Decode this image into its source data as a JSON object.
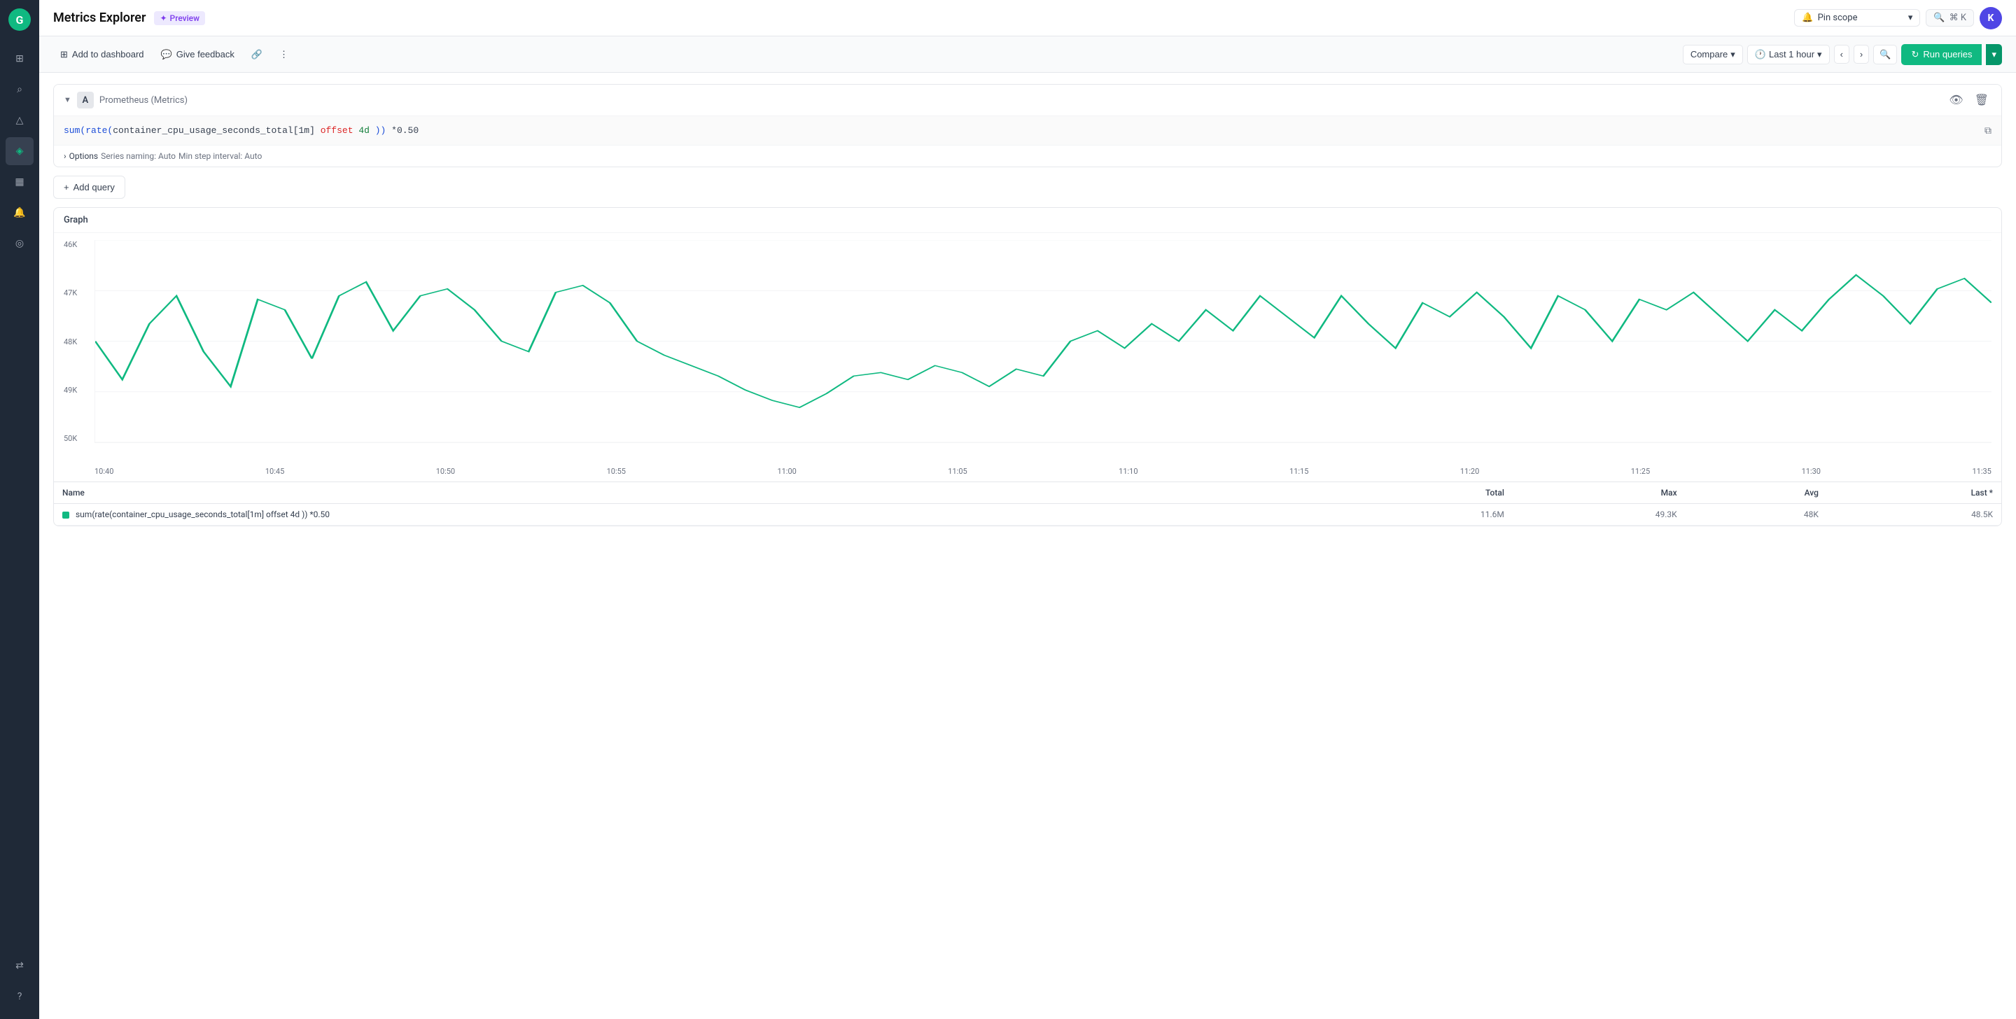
{
  "app": {
    "title": "Metrics Explorer",
    "preview_label": "Preview"
  },
  "sidebar": {
    "logo": "G",
    "items": [
      {
        "name": "home",
        "icon": "⊞",
        "active": false
      },
      {
        "name": "search",
        "icon": "⌕",
        "active": false
      },
      {
        "name": "alerts",
        "icon": "△",
        "active": false
      },
      {
        "name": "metrics",
        "icon": "◈",
        "active": true
      },
      {
        "name": "dashboard",
        "icon": "▦",
        "active": false
      },
      {
        "name": "bell",
        "icon": "🔔",
        "active": false
      },
      {
        "name": "explore",
        "icon": "◎",
        "active": false
      }
    ],
    "bottom_items": [
      {
        "name": "integrations",
        "icon": "⇄"
      },
      {
        "name": "help",
        "icon": "?"
      }
    ]
  },
  "pinscope": {
    "label": "Pin scope",
    "icon": "🔔",
    "placeholder": "Pin scope"
  },
  "search": {
    "label": "⌘ K"
  },
  "user": {
    "avatar_letter": "K"
  },
  "toolbar": {
    "add_to_dashboard_label": "Add to dashboard",
    "give_feedback_label": "Give feedback",
    "compare_label": "Compare",
    "time_label": "Last 1 hour",
    "run_queries_label": "Run queries"
  },
  "query": {
    "collapse_icon": "▼",
    "label": "A",
    "source": "Prometheus (Metrics)",
    "code": "sum(rate(container_cpu_usage_seconds_total[1m] offset 4d )) *0.50",
    "code_parts": [
      {
        "text": "sum(",
        "class": "kw-blue"
      },
      {
        "text": "rate(",
        "class": "kw-blue"
      },
      {
        "text": "container_cpu_usage_seconds_total",
        "class": "kw-gray"
      },
      {
        "text": "[1m]",
        "class": "kw-gray"
      },
      {
        "text": " offset ",
        "class": "kw-red"
      },
      {
        "text": "4d ",
        "class": "kw-green"
      },
      {
        "text": ")) ",
        "class": "kw-blue"
      },
      {
        "text": "*0.50",
        "class": "kw-gray"
      }
    ],
    "options_label": "Options",
    "series_naming": "Series naming: Auto",
    "min_step": "Min step interval: Auto"
  },
  "add_query": {
    "label": "Add query"
  },
  "graph": {
    "title": "Graph",
    "y_labels": [
      "46K",
      "47K",
      "48K",
      "49K",
      "50K"
    ],
    "x_labels": [
      "10:40",
      "10:45",
      "10:50",
      "10:55",
      "11:00",
      "11:05",
      "11:10",
      "11:15",
      "11:20",
      "11:25",
      "11:30",
      "11:35"
    ]
  },
  "table": {
    "columns": [
      "Name",
      "Total",
      "Max",
      "Avg",
      "Last *"
    ],
    "rows": [
      {
        "color": "#10b981",
        "name": "sum(rate(container_cpu_usage_seconds_total[1m] offset 4d )) *0.50",
        "total": "11.6M",
        "max": "49.3K",
        "avg": "48K",
        "last": "48.5K"
      }
    ]
  }
}
